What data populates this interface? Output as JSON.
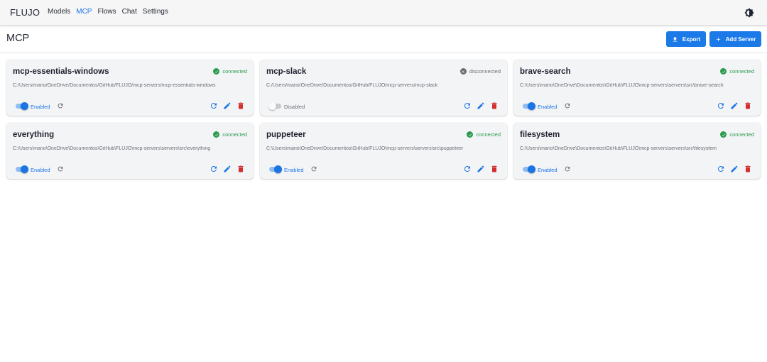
{
  "app": {
    "brand": "FLUJO"
  },
  "nav": {
    "items": [
      {
        "label": "Models",
        "active": false
      },
      {
        "label": "MCP",
        "active": true
      },
      {
        "label": "Flows",
        "active": false
      },
      {
        "label": "Chat",
        "active": false
      },
      {
        "label": "Settings",
        "active": false
      }
    ]
  },
  "header": {
    "title": "MCP",
    "export_label": "Export",
    "add_server_label": "Add Server"
  },
  "colors": {
    "accent": "#1b7ae8",
    "connected": "#2c9b4d",
    "disconnected": "#6b6e76",
    "delete": "#d32f2f"
  },
  "servers": [
    {
      "name": "mcp-essentials-windows",
      "status": "connected",
      "path": "C:/Users/mario/OneDrive/Documentos/GitHub/FLUJO/mcp-servers/mcp-essentials-windows",
      "enabled": true,
      "toggle_label": "Enabled"
    },
    {
      "name": "mcp-slack",
      "status": "disconnected",
      "path": "C:/Users/mario/OneDrive/Documentos/GitHub/FLUJO/mcp-servers/mcp-slack",
      "enabled": false,
      "toggle_label": "Disabled"
    },
    {
      "name": "brave-search",
      "status": "connected",
      "path": "C:\\Users\\mario\\OneDrive\\Documentos\\GitHub\\FLUJO\\mcp-servers\\servers\\src\\brave-search",
      "enabled": true,
      "toggle_label": "Enabled"
    },
    {
      "name": "everything",
      "status": "connected",
      "path": "C:\\Users\\mario\\OneDrive\\Documentos\\GitHub\\FLUJO\\mcp-servers\\servers\\src\\everything",
      "enabled": true,
      "toggle_label": "Enabled"
    },
    {
      "name": "puppeteer",
      "status": "connected",
      "path": "C:\\Users\\mario\\OneDrive\\Documentos\\GitHub\\FLUJO\\mcp-servers\\servers\\src\\puppeteer",
      "enabled": true,
      "toggle_label": "Enabled"
    },
    {
      "name": "filesystem",
      "status": "connected",
      "path": "C:\\Users\\mario\\OneDrive\\Documentos\\GitHub\\FLUJO\\mcp-servers\\servers\\src\\filesystem",
      "enabled": true,
      "toggle_label": "Enabled"
    }
  ]
}
